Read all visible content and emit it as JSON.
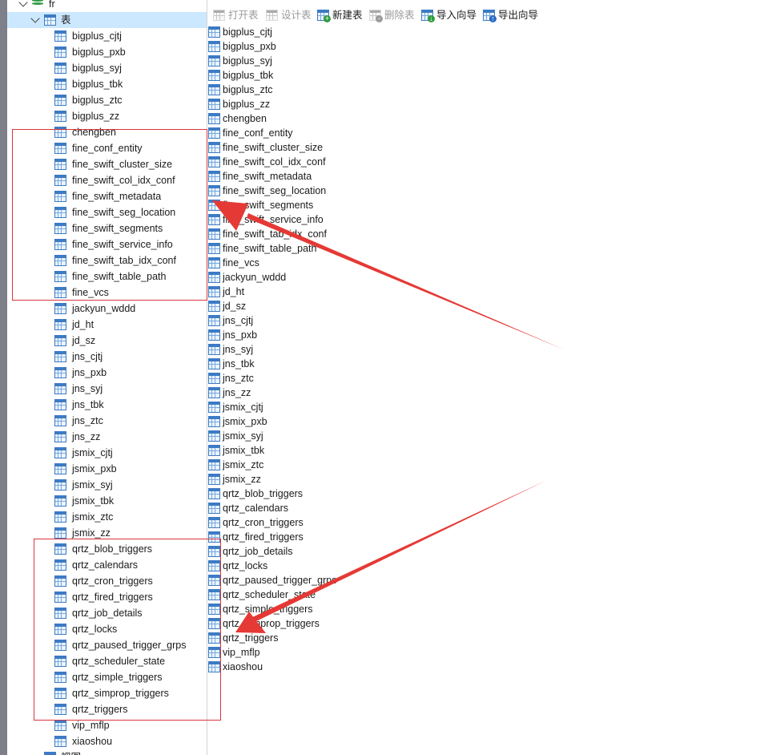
{
  "tree": {
    "database": {
      "label": "fr"
    },
    "tables_group": {
      "label": "表"
    },
    "tables": [
      "bigplus_cjtj",
      "bigplus_pxb",
      "bigplus_syj",
      "bigplus_tbk",
      "bigplus_ztc",
      "bigplus_zz",
      "chengben",
      "fine_conf_entity",
      "fine_swift_cluster_size",
      "fine_swift_col_idx_conf",
      "fine_swift_metadata",
      "fine_swift_seg_location",
      "fine_swift_segments",
      "fine_swift_service_info",
      "fine_swift_tab_idx_conf",
      "fine_swift_table_path",
      "fine_vcs",
      "jackyun_wddd",
      "jd_ht",
      "jd_sz",
      "jns_cjtj",
      "jns_pxb",
      "jns_syj",
      "jns_tbk",
      "jns_ztc",
      "jns_zz",
      "jsmix_cjtj",
      "jsmix_pxb",
      "jsmix_syj",
      "jsmix_tbk",
      "jsmix_ztc",
      "jsmix_zz",
      "qrtz_blob_triggers",
      "qrtz_calendars",
      "qrtz_cron_triggers",
      "qrtz_fired_triggers",
      "qrtz_job_details",
      "qrtz_locks",
      "qrtz_paused_trigger_grps",
      "qrtz_scheduler_state",
      "qrtz_simple_triggers",
      "qrtz_simprop_triggers",
      "qrtz_triggers",
      "vip_mflp",
      "xiaoshou"
    ],
    "next_group": {
      "label": "视图"
    }
  },
  "toolbar": {
    "open_table": "打开表",
    "design_table": "设计表",
    "new_table": "新建表",
    "delete_table": "删除表",
    "import_wizard": "导入向导",
    "export_wizard": "导出向导"
  },
  "content": {
    "tables": [
      "bigplus_cjtj",
      "bigplus_pxb",
      "bigplus_syj",
      "bigplus_tbk",
      "bigplus_ztc",
      "bigplus_zz",
      "chengben",
      "fine_conf_entity",
      "fine_swift_cluster_size",
      "fine_swift_col_idx_conf",
      "fine_swift_metadata",
      "fine_swift_seg_location",
      "fine_swift_segments",
      "fine_swift_service_info",
      "fine_swift_tab_idx_conf",
      "fine_swift_table_path",
      "fine_vcs",
      "jackyun_wddd",
      "jd_ht",
      "jd_sz",
      "jns_cjtj",
      "jns_pxb",
      "jns_syj",
      "jns_tbk",
      "jns_ztc",
      "jns_zz",
      "jsmix_cjtj",
      "jsmix_pxb",
      "jsmix_syj",
      "jsmix_tbk",
      "jsmix_ztc",
      "jsmix_zz",
      "qrtz_blob_triggers",
      "qrtz_calendars",
      "qrtz_cron_triggers",
      "qrtz_fired_triggers",
      "qrtz_job_details",
      "qrtz_locks",
      "qrtz_paused_trigger_grps",
      "qrtz_scheduler_state",
      "qrtz_simple_triggers",
      "qrtz_simprop_triggers",
      "qrtz_triggers",
      "vip_mflp",
      "xiaoshou"
    ]
  },
  "colors": {
    "annotation": "#e53935",
    "selection": "#cce8ff",
    "table_icon": "#3d7bc4"
  }
}
